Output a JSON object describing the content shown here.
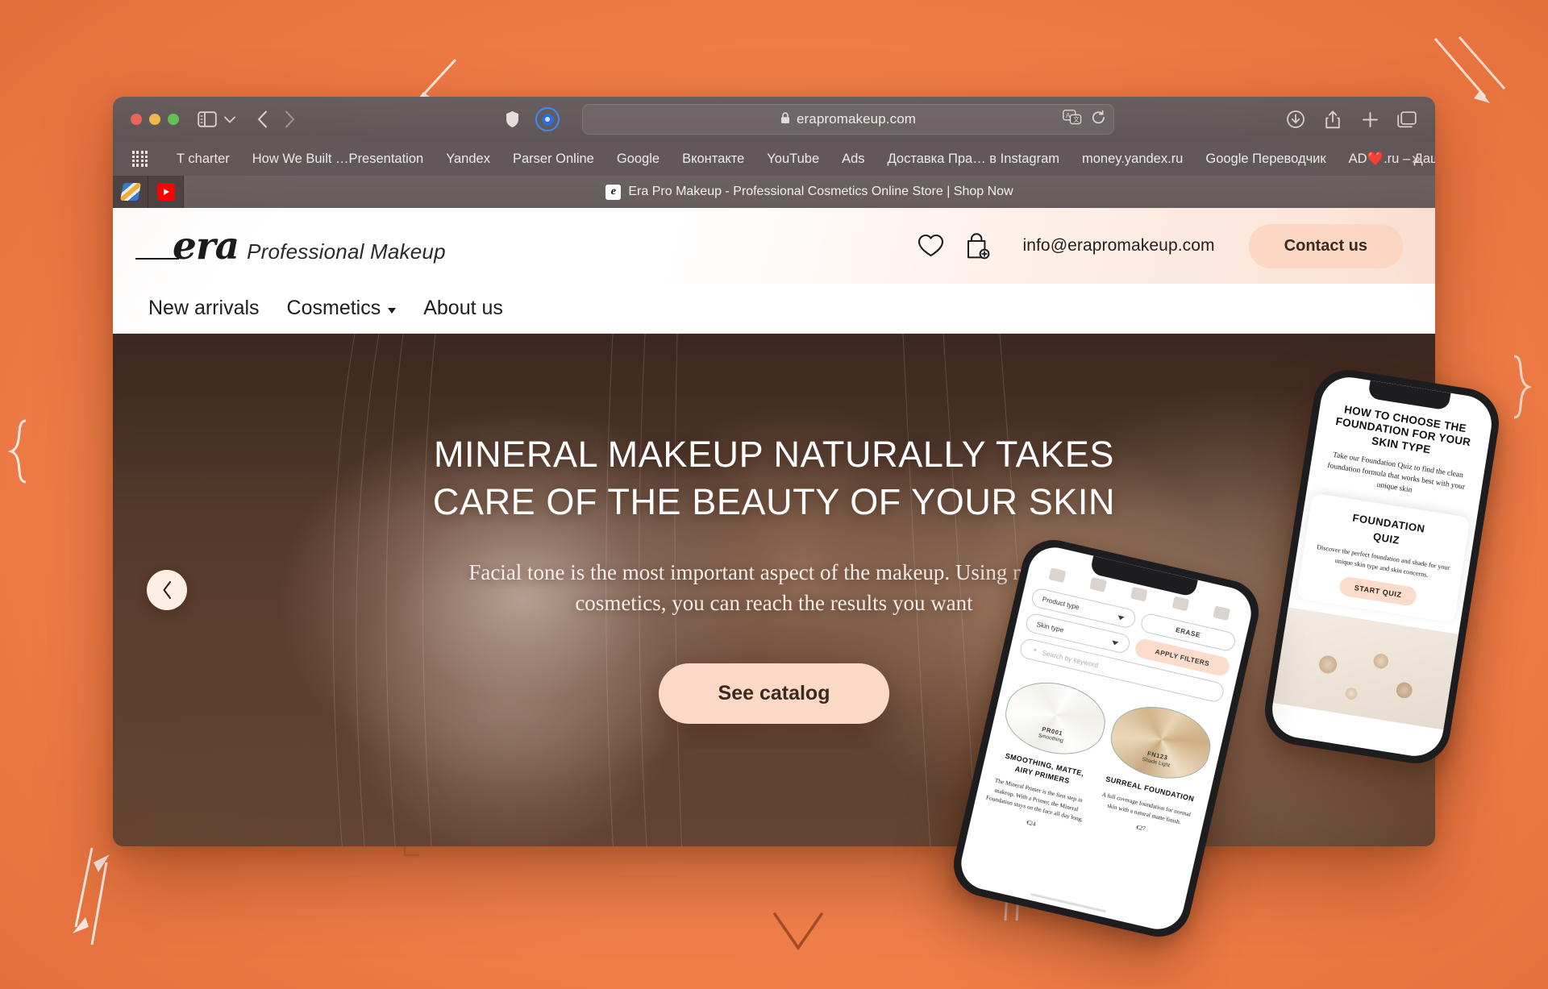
{
  "browser": {
    "window_controls": [
      "close",
      "minimize",
      "maximize"
    ],
    "address": {
      "url": "erapromakeup.com",
      "lock_icon": "lock-icon",
      "translate_icon": "translate-icon",
      "reload_icon": "reload-icon"
    },
    "toolbar_icons": [
      "sidebar-icon",
      "chevron-down-icon",
      "back-icon",
      "forward-icon",
      "shield-icon",
      "extension-icon",
      "downloads-icon",
      "share-icon",
      "new-tab-icon",
      "tab-overview-icon"
    ],
    "bookmarks": [
      "T charter",
      "How We Built …Presentation",
      "Yandex",
      "Parser Online",
      "Google",
      "Вконтакте",
      "YouTube",
      "Ads",
      "Доставка Пра… в Instagram",
      "money.yandex.ru",
      "Google Переводчик",
      "AD❤️.ru – Дашбоард"
    ],
    "bookmarks_overflow": "»",
    "tabs": {
      "pinned": [
        "pinned-tab-1",
        "pinned-tab-youtube"
      ],
      "active": {
        "favicon_letter": "e",
        "title": "Era Pro Makeup - Professional Cosmetics Online Store | Shop Now"
      }
    }
  },
  "site": {
    "header": {
      "logo_mark": "era",
      "logo_sub": "Professional Makeup",
      "wishlist_icon": "heart-icon",
      "cart_icon": "shopping-bag-add-icon",
      "email": "info@erapromakeup.com",
      "contact_label": "Contact us"
    },
    "nav": [
      {
        "label": "New arrivals",
        "has_caret": false
      },
      {
        "label": "Cosmetics",
        "has_caret": true
      },
      {
        "label": "About us",
        "has_caret": false
      }
    ],
    "hero": {
      "heading_line1": "MINERAL MAKEUP NATURALLY TAKES",
      "heading_line2": "CARE OF THE BEAUTY OF YOUR SKIN",
      "sub_line1": "Facial tone is the most important aspect of the makeup. Using mineral",
      "sub_line2": "cosmetics, you can reach the results you want",
      "cta_label": "See catalog",
      "prev_icon": "chevron-left-icon"
    }
  },
  "phone_right": {
    "title": "HOW TO CHOOSE THE FOUNDATION FOR YOUR SKIN TYPE",
    "description": "Take our Foundation Quiz to find the clean foundation formula that works best with your unique skin",
    "card_title_line1": "FOUNDATION",
    "card_title_line2": "QUIZ",
    "card_text": "Discover the perfect foundation and shade for your unique skin type and skin concerns.",
    "card_button": "START QUIZ"
  },
  "phone_left": {
    "filters": {
      "product_type": "Product type",
      "erase": "ERASE",
      "skin_type": "Skin type",
      "apply": "APPLY FILTERS",
      "search_placeholder": "Search by keyword"
    },
    "products": [
      {
        "swatch_code": "PR001",
        "swatch_name": "Smoothing",
        "title": "SMOOTHING, MATTE, AIRY PRIMERS",
        "description": "The Mineral Primer is the first step in makeup. With a Primer, the Mineral Foundation stays on the face all day long.",
        "price": "€24"
      },
      {
        "swatch_code": "FN123",
        "swatch_name": "Shade Light",
        "title": "SURREAL FOUNDATION",
        "description": "A full coverage foundation for normal skin with a natural matte finish.",
        "price": "€27"
      }
    ]
  },
  "colors": {
    "background_orange": "#ef7b45",
    "accent_peach": "#fcd9c6",
    "chrome_gray": "#60585a",
    "hero_dark": "#4b362c"
  }
}
